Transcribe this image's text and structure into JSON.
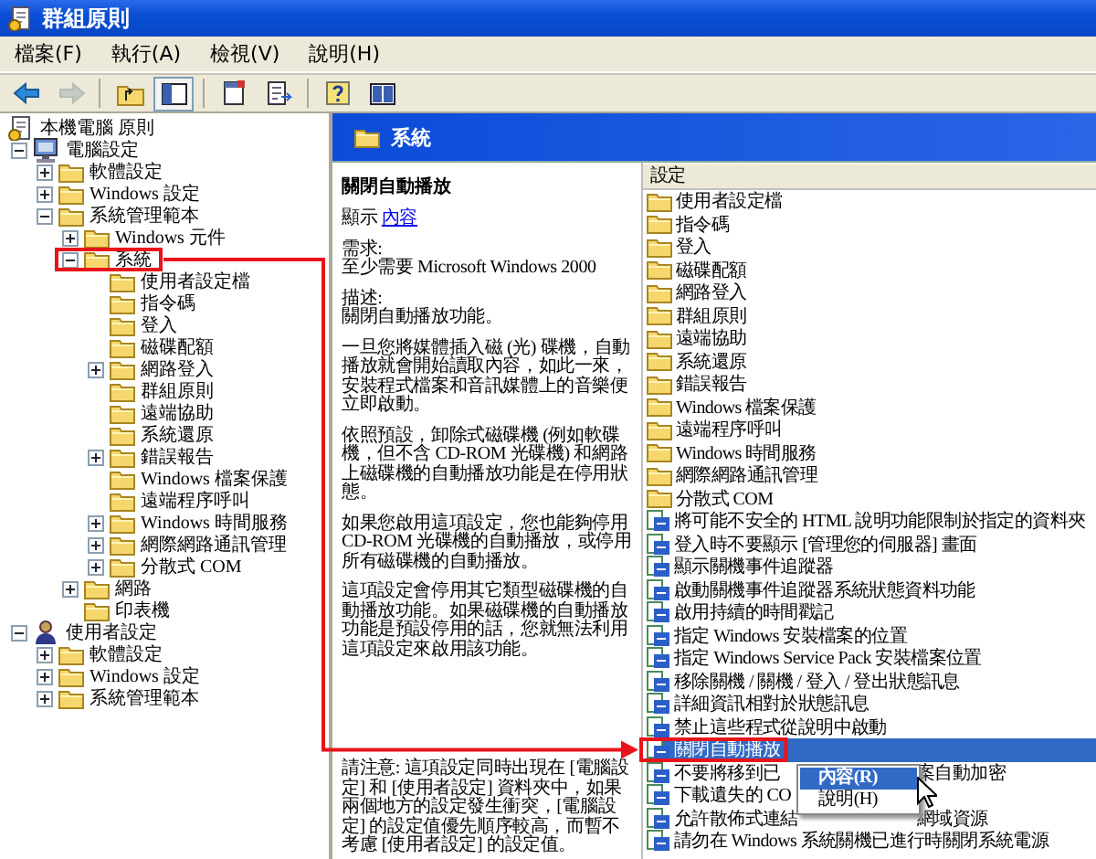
{
  "window": {
    "title": "群組原則"
  },
  "menu": [
    {
      "label": "檔案(F)"
    },
    {
      "label": "執行(A)"
    },
    {
      "label": "檢視(V)"
    },
    {
      "label": "說明(H)"
    }
  ],
  "toolbar": [
    {
      "kind": "back",
      "disabled": false,
      "pressed": false
    },
    {
      "kind": "forward",
      "disabled": true,
      "pressed": false
    },
    {
      "kind": "separator"
    },
    {
      "kind": "up",
      "disabled": false,
      "pressed": false
    },
    {
      "kind": "tree",
      "disabled": false,
      "pressed": true
    },
    {
      "kind": "separator"
    },
    {
      "kind": "properties",
      "disabled": false,
      "pressed": false
    },
    {
      "kind": "export",
      "disabled": false,
      "pressed": false
    },
    {
      "kind": "separator"
    },
    {
      "kind": "help",
      "disabled": false,
      "pressed": false
    },
    {
      "kind": "view",
      "disabled": false,
      "pressed": false
    }
  ],
  "tree": {
    "label": "本機電腦 原則",
    "kind": "policy",
    "annotated": false,
    "children": [
      {
        "label": "電腦設定",
        "kind": "computer",
        "expanded": true,
        "annotated": false,
        "children": [
          {
            "label": "軟體設定",
            "kind": "folder",
            "expanded": false,
            "annotated": false
          },
          {
            "label": "Windows 設定",
            "kind": "folder",
            "expanded": false,
            "annotated": false
          },
          {
            "label": "系統管理範本",
            "kind": "folder",
            "expanded": true,
            "annotated": false,
            "children": [
              {
                "label": "Windows 元件",
                "kind": "folder",
                "expanded": false,
                "annotated": false
              },
              {
                "label": "系統",
                "kind": "folder",
                "expanded": true,
                "annotated": true,
                "children": [
                  {
                    "label": "使用者設定檔",
                    "kind": "folder",
                    "annotated": false
                  },
                  {
                    "label": "指令碼",
                    "kind": "folder",
                    "annotated": false
                  },
                  {
                    "label": "登入",
                    "kind": "folder",
                    "annotated": false
                  },
                  {
                    "label": "磁碟配額",
                    "kind": "folder",
                    "annotated": false
                  },
                  {
                    "label": "網路登入",
                    "kind": "folder",
                    "expanded": false,
                    "annotated": false
                  },
                  {
                    "label": "群組原則",
                    "kind": "folder",
                    "annotated": false
                  },
                  {
                    "label": "遠端協助",
                    "kind": "folder",
                    "annotated": false
                  },
                  {
                    "label": "系統還原",
                    "kind": "folder",
                    "annotated": false
                  },
                  {
                    "label": "錯誤報告",
                    "kind": "folder",
                    "expanded": false,
                    "annotated": false
                  },
                  {
                    "label": "Windows 檔案保護",
                    "kind": "folder",
                    "annotated": false
                  },
                  {
                    "label": "遠端程序呼叫",
                    "kind": "folder",
                    "annotated": false
                  },
                  {
                    "label": "Windows 時間服務",
                    "kind": "folder",
                    "expanded": false,
                    "annotated": false
                  },
                  {
                    "label": "網際網路通訊管理",
                    "kind": "folder",
                    "expanded": false,
                    "annotated": false
                  },
                  {
                    "label": "分散式 COM",
                    "kind": "folder",
                    "expanded": false,
                    "annotated": false
                  }
                ]
              },
              {
                "label": "網路",
                "kind": "folder",
                "expanded": false,
                "annotated": false
              },
              {
                "label": "印表機",
                "kind": "folder",
                "annotated": false
              }
            ]
          }
        ]
      },
      {
        "label": "使用者設定",
        "kind": "user",
        "expanded": true,
        "annotated": false,
        "children": [
          {
            "label": "軟體設定",
            "kind": "folder",
            "expanded": false,
            "annotated": false
          },
          {
            "label": "Windows 設定",
            "kind": "folder",
            "expanded": false,
            "annotated": false
          },
          {
            "label": "系統管理範本",
            "kind": "folder",
            "expanded": false,
            "annotated": false
          }
        ]
      }
    ]
  },
  "pane_header": {
    "title": "系統"
  },
  "description": {
    "title": "關閉自動播放",
    "show_prefix": "顯示",
    "show_link": "內容",
    "sections": [
      [
        "需求:",
        "至少需要 Microsoft Windows 2000"
      ],
      [
        "描述:",
        "關閉自動播放功能。"
      ],
      [
        "一旦您將媒體插入磁 (光) 碟機，自動播放就會開始讀取內容，如此一來，安裝程式檔案和音訊媒體上的音樂便立即啟動。"
      ],
      [
        "依照預設，卸除式磁碟機 (例如軟碟機，但不含 CD-ROM 光碟機) 和網路上磁碟機的自動播放功能是在停用狀態。"
      ],
      [
        "如果您啟用這項設定，您也能夠停用 CD-ROM 光碟機的自動播放，或停用所有磁碟機的自動播放。"
      ],
      [
        "這項設定會停用其它類型磁碟機的自動播放功能。如果磁碟機的自動播放功能是預設停用的話，您就無法利用這項設定來啟用該功能。"
      ],
      [
        "請注意: 這項設定同時出現在 [電腦設定] 和 [使用者設定] 資料夾中，如果兩個地方的設定發生衝突，[電腦設定] 的設定值優先順序較高，而暫不考慮 [使用者設定] 的設定值。"
      ]
    ]
  },
  "list": {
    "column": "設定",
    "rows": [
      {
        "kind": "folder",
        "label": "使用者設定檔",
        "selected": false,
        "annotated": false
      },
      {
        "kind": "folder",
        "label": "指令碼",
        "selected": false,
        "annotated": false
      },
      {
        "kind": "folder",
        "label": "登入",
        "selected": false,
        "annotated": false
      },
      {
        "kind": "folder",
        "label": "磁碟配額",
        "selected": false,
        "annotated": false
      },
      {
        "kind": "folder",
        "label": "網路登入",
        "selected": false,
        "annotated": false
      },
      {
        "kind": "folder",
        "label": "群組原則",
        "selected": false,
        "annotated": false
      },
      {
        "kind": "folder",
        "label": "遠端協助",
        "selected": false,
        "annotated": false
      },
      {
        "kind": "folder",
        "label": "系統還原",
        "selected": false,
        "annotated": false
      },
      {
        "kind": "folder",
        "label": "錯誤報告",
        "selected": false,
        "annotated": false
      },
      {
        "kind": "folder",
        "label": "Windows 檔案保護",
        "selected": false,
        "annotated": false
      },
      {
        "kind": "folder",
        "label": "遠端程序呼叫",
        "selected": false,
        "annotated": false
      },
      {
        "kind": "folder",
        "label": "Windows 時間服務",
        "selected": false,
        "annotated": false
      },
      {
        "kind": "folder",
        "label": "網際網路通訊管理",
        "selected": false,
        "annotated": false
      },
      {
        "kind": "folder",
        "label": "分散式 COM",
        "selected": false,
        "annotated": false
      },
      {
        "kind": "setting",
        "label": "將可能不安全的 HTML 說明功能限制於指定的資料夾",
        "selected": false,
        "annotated": false
      },
      {
        "kind": "setting",
        "label": "登入時不要顯示 [管理您的伺服器] 畫面",
        "selected": false,
        "annotated": false
      },
      {
        "kind": "setting",
        "label": "顯示關機事件追蹤器",
        "selected": false,
        "annotated": false
      },
      {
        "kind": "setting",
        "label": "啟動關機事件追蹤器系統狀態資料功能",
        "selected": false,
        "annotated": false
      },
      {
        "kind": "setting",
        "label": "啟用持續的時間戳記",
        "selected": false,
        "annotated": false
      },
      {
        "kind": "setting",
        "label": "指定 Windows 安裝檔案的位置",
        "selected": false,
        "annotated": false
      },
      {
        "kind": "setting",
        "label": "指定 Windows Service Pack 安裝檔案位置",
        "selected": false,
        "annotated": false
      },
      {
        "kind": "setting",
        "label": "移除關機 / 關機 / 登入 / 登出狀態訊息",
        "selected": false,
        "annotated": false
      },
      {
        "kind": "setting",
        "label": "詳細資訊相對於狀態訊息",
        "selected": false,
        "annotated": false
      },
      {
        "kind": "setting",
        "label": "禁止這些程式從說明中啟動",
        "selected": false,
        "annotated": false
      },
      {
        "kind": "setting",
        "label": "關閉自動播放",
        "selected": true,
        "annotated": true
      },
      {
        "kind": "setting",
        "label": "不要將移到已",
        "label_tail": "案自動加密",
        "selected": false,
        "annotated": false
      },
      {
        "kind": "setting",
        "label": "下載遺失的 CO",
        "selected": false,
        "annotated": false
      },
      {
        "kind": "setting",
        "label": "允許散佈式連結",
        "label_tail": "網域資源",
        "selected": false,
        "annotated": false
      },
      {
        "kind": "setting",
        "label": "請勿在 Windows 系統關機已進行時關閉系統電源",
        "selected": false,
        "annotated": false
      }
    ]
  },
  "context_menu": [
    {
      "label": "內容(R)",
      "selected": true
    },
    {
      "label": "說明(H)",
      "selected": false
    }
  ]
}
